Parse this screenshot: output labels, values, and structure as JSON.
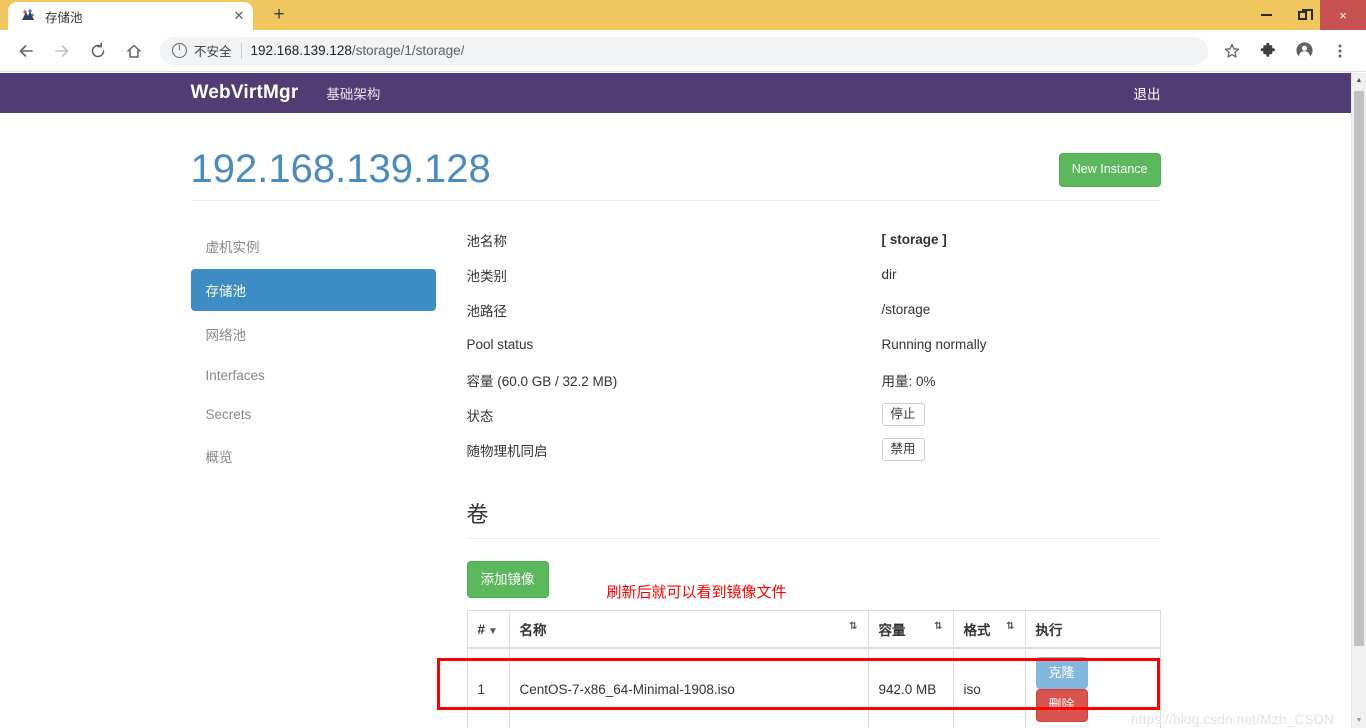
{
  "browser": {
    "tab": {
      "title": "存储池",
      "favicon_icon": "app-favicon",
      "close_icon": "close-icon"
    },
    "new_tab_label": "+",
    "window": {
      "minimize_label": "minimize",
      "maximize_label": "maximize",
      "close_label": "×"
    },
    "nav": {
      "back_icon": "arrow-left-icon",
      "forward_icon": "arrow-right-icon",
      "reload_icon": "reload-icon",
      "home_icon": "home-icon"
    },
    "omnibox": {
      "info_icon": "info-circle-icon",
      "security_label": "不安全",
      "url_host": "192.168.139.128",
      "url_path": "/storage/1/storage/"
    },
    "toolbar_right": {
      "bookmark_icon": "star-icon",
      "extensions_icon": "puzzle-icon",
      "profile_icon": "account-avatar-icon",
      "menu_icon": "more-vertical-icon"
    },
    "scrollbar": {
      "up_icon": "caret-up-icon",
      "down_icon": "caret-down-icon"
    }
  },
  "navbar": {
    "brand": "WebVirtMgr",
    "links": [
      {
        "label": "基础架构"
      }
    ],
    "logout_label": "退出",
    "background_color": "#513c73"
  },
  "header": {
    "title": "192.168.139.128",
    "title_color": "#4a8bc2",
    "new_instance_label": "New Instance",
    "new_instance_color": "#5cb85c"
  },
  "sidebar": {
    "items": [
      {
        "label": "虚机实例",
        "active": false
      },
      {
        "label": "存储池",
        "active": true
      },
      {
        "label": "网络池",
        "active": false
      },
      {
        "label": "Interfaces",
        "active": false
      },
      {
        "label": "Secrets",
        "active": false
      },
      {
        "label": "概览",
        "active": false
      }
    ],
    "active_color": "#3c8dc5"
  },
  "details": [
    {
      "term": "池名称",
      "value": "[ storage ]",
      "bold": true,
      "type": "text"
    },
    {
      "term": "池类别",
      "value": "dir",
      "type": "text"
    },
    {
      "term": "池路径",
      "value": "/storage",
      "type": "text"
    },
    {
      "term": "Pool status",
      "value": "Running normally",
      "type": "text"
    },
    {
      "term": "容量 (60.0 GB / 32.2 MB)",
      "value": "用量: 0%",
      "type": "text"
    },
    {
      "term": "状态",
      "value": "停止",
      "type": "label"
    },
    {
      "term": "随物理机同启",
      "value": "禁用",
      "type": "label"
    }
  ],
  "details_flat": {
    "pool_name_term": "池名称",
    "pool_name_value": "[ storage ]",
    "pool_type_term": "池类别",
    "pool_type_value": "dir",
    "pool_path_term": "池路径",
    "pool_path_value": "/storage",
    "pool_status_term": "Pool status",
    "pool_status_value": "Running normally",
    "capacity_term": "容量 (60.0 GB / 32.2 MB)",
    "capacity_value": "用量: 0%",
    "state_term": "状态",
    "state_value": "停止",
    "autostart_term": "随物理机同启",
    "autostart_value": "禁用"
  },
  "volumes": {
    "section_title": "卷",
    "add_image_label": "添加镜像",
    "annotation": "刷新后就可以看到镜像文件",
    "annotation_color": "#ff0000",
    "columns": {
      "index": "#",
      "name": "名称",
      "size": "容量",
      "format": "格式",
      "action": "执行"
    },
    "sort_caret_icon": "caret-down-icon",
    "sort_both_icon": "sort-both-icon",
    "rows": [
      {
        "index": "1",
        "name": "CentOS-7-x86_64-Minimal-1908.iso",
        "size": "942.0 MB",
        "format": "iso",
        "clone_label": "克隆",
        "delete_label": "删除"
      }
    ]
  },
  "watermark": "https://blog.csdn.net/Mzh_CSDN",
  "highlight_color": "#ff0000"
}
